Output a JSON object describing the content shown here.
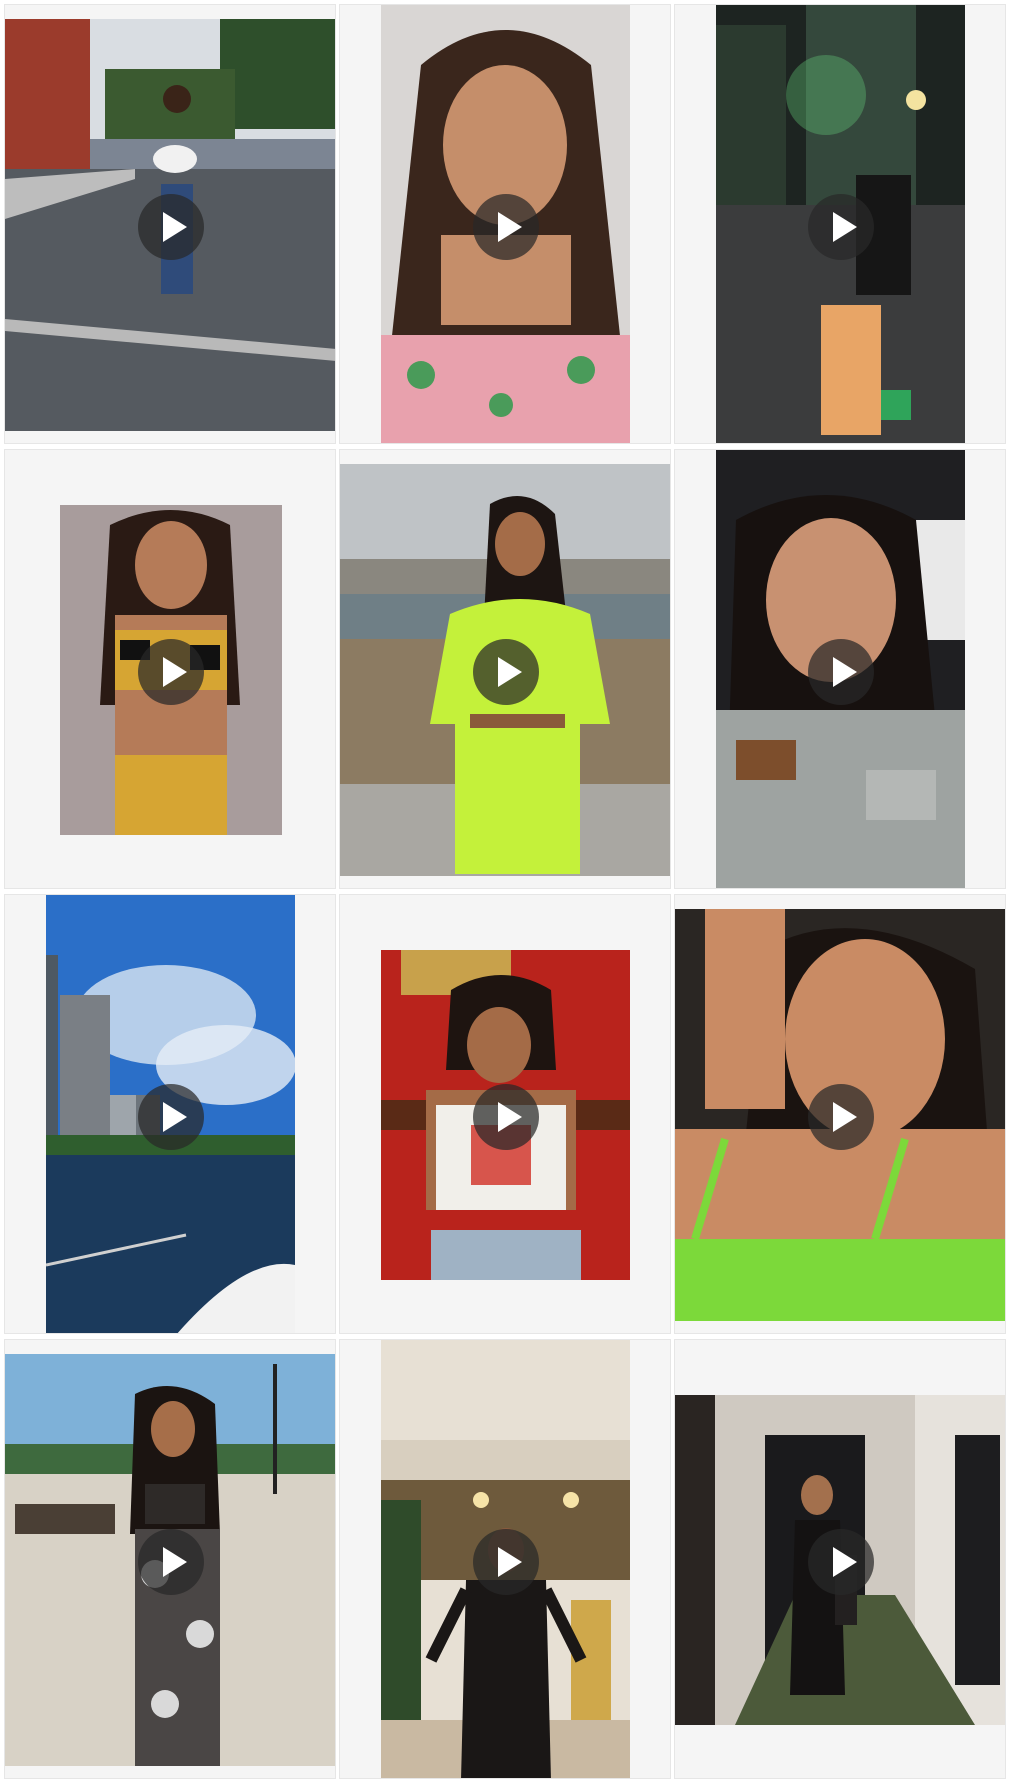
{
  "gallery": {
    "icon": "play-icon",
    "accent": "#2b2b2b",
    "items": [
      {
        "id": "video-1",
        "scene": "parking-lot"
      },
      {
        "id": "video-2",
        "scene": "floral-top-portrait"
      },
      {
        "id": "video-3",
        "scene": "city-night-street"
      },
      {
        "id": "video-4",
        "scene": "print-two-piece"
      },
      {
        "id": "video-5",
        "scene": "lime-outfit-waterfront"
      },
      {
        "id": "video-6",
        "scene": "car-selfie"
      },
      {
        "id": "video-7",
        "scene": "skyline-boat"
      },
      {
        "id": "video-8",
        "scene": "red-restaurant"
      },
      {
        "id": "video-9",
        "scene": "green-top-selfie"
      },
      {
        "id": "video-10",
        "scene": "boardwalk"
      },
      {
        "id": "video-11",
        "scene": "ornate-lobby"
      },
      {
        "id": "video-12",
        "scene": "hotel-hallway"
      }
    ]
  }
}
